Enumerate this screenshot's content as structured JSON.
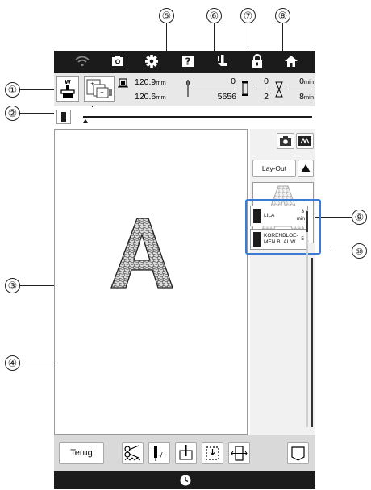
{
  "topbar": {
    "icons": [
      "wifi-icon",
      "camera-icon",
      "gear-icon",
      "help-icon",
      "presser-foot-icon",
      "lock-icon",
      "home-icon"
    ]
  },
  "info": {
    "width": "120.9",
    "height": "120.6",
    "size_unit": "mm",
    "stitch_current": "0",
    "stitch_total": "5656",
    "color_current": "0",
    "color_total": "2",
    "time_current": "0",
    "time_total": "8",
    "time_unit": "min"
  },
  "right_panel": {
    "layout_label": "Lay-Out",
    "threads": [
      {
        "name": "LILA",
        "value": "3",
        "unit": "min"
      },
      {
        "name": "KORENBLOE-\nMEN BLAUW",
        "value": "5",
        "unit": ""
      }
    ]
  },
  "bottom": {
    "back_label": "Terug"
  },
  "callouts": [
    "①",
    "②",
    "③",
    "④",
    "⑤",
    "⑥",
    "⑦",
    "⑧",
    "⑨",
    "⑩"
  ],
  "colors": {
    "bar_dark": "#1b1b1b",
    "info_bg": "#e8e8e8",
    "callout_box": "#3a7bd5"
  }
}
